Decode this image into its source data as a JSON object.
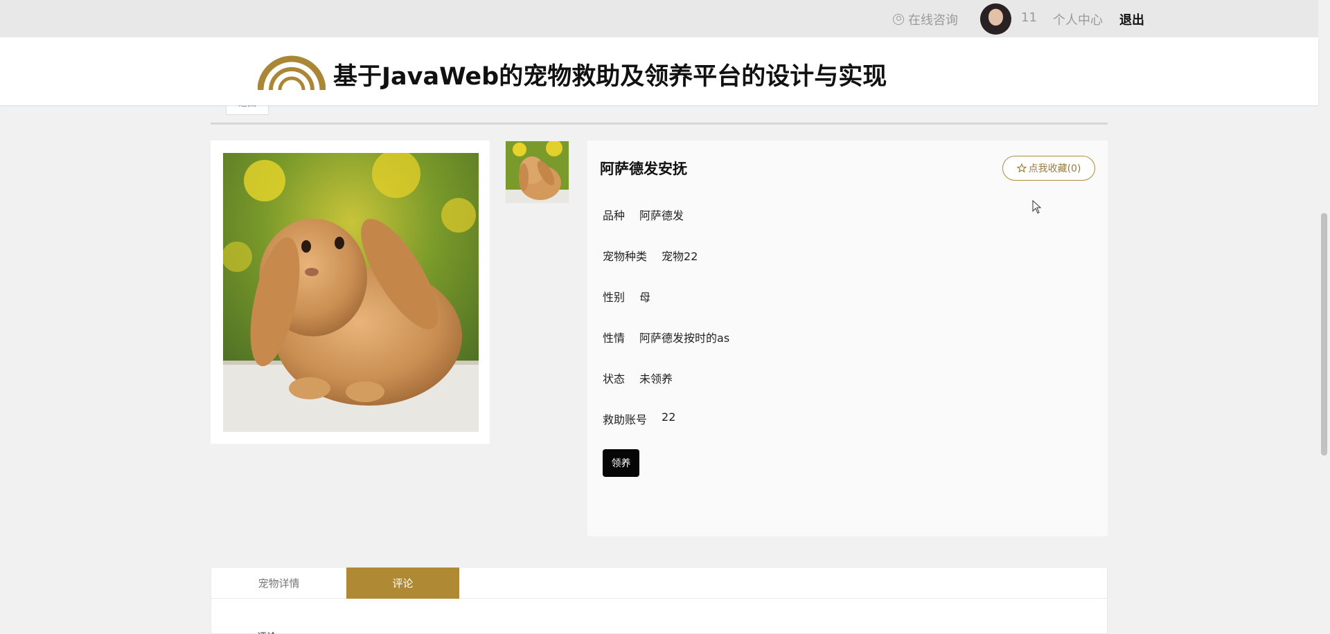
{
  "topbar": {
    "consult_label": "在线咨询",
    "username": "11",
    "center_label": "个人中心",
    "logout_label": "退出"
  },
  "header": {
    "title": "基于JavaWeb的宠物救助及领养平台的设计与实现"
  },
  "back_label": "返回",
  "pet": {
    "name": "阿萨德发安抚",
    "favorite_label": "点我收藏(0)",
    "fields": [
      {
        "label": "品种",
        "value": "阿萨德发"
      },
      {
        "label": "宠物种类",
        "value": "宠物22"
      },
      {
        "label": "性别",
        "value": "母"
      },
      {
        "label": "性情",
        "value": "阿萨德发按时的as"
      },
      {
        "label": "状态",
        "value": "未领养"
      },
      {
        "label": "救助账号",
        "value": "22"
      }
    ],
    "adopt_label": "领养"
  },
  "tabs": [
    {
      "label": "宠物详情",
      "active": false
    },
    {
      "label": "评论",
      "active": true
    }
  ],
  "comment_peek": "评论",
  "colors": {
    "accent": "#b08935",
    "topbar_bg": "#e9e8e9",
    "page_bg": "#f2f1f2"
  },
  "icons": {
    "consult": "user-circle-icon",
    "favorite": "star-outline-icon"
  }
}
